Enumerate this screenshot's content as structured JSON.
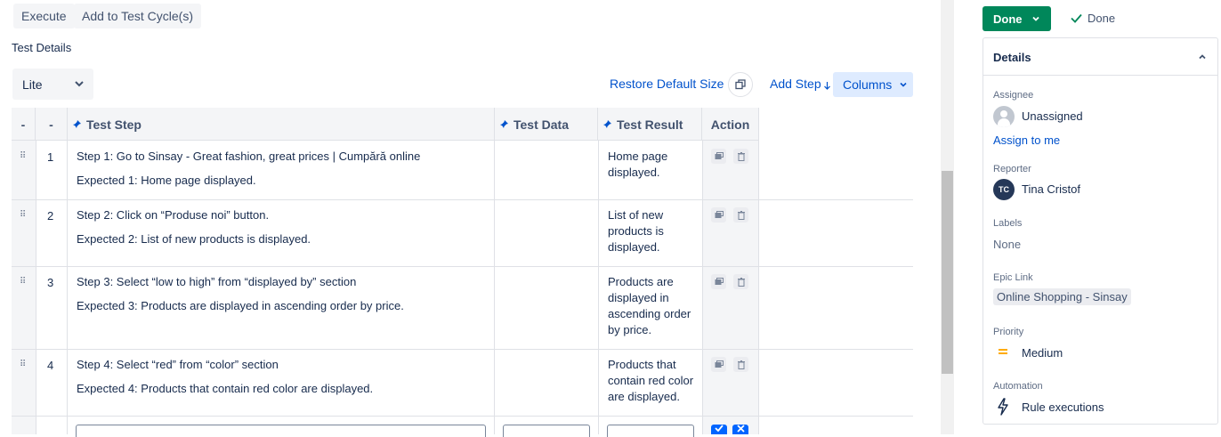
{
  "toolbar": {
    "execute": "Execute",
    "add_to_cycle": "Add to Test Cycle(s)"
  },
  "section_title": "Test Details",
  "view_select": {
    "value": "Lite"
  },
  "actions": {
    "restore": "Restore Default Size",
    "add_step": "Add Step",
    "columns": "Columns"
  },
  "table": {
    "headers": {
      "col1": "-",
      "col2": "-",
      "step": "Test Step",
      "data": "Test Data",
      "result": "Test Result",
      "action": "Action"
    },
    "rows": [
      {
        "num": "1",
        "step": "Step 1: Go to Sinsay - Great fashion, great prices | Cumpără online",
        "expected": "Expected 1: Home page displayed.",
        "result_lines": [
          "Home page",
          "displayed."
        ]
      },
      {
        "num": "2",
        "step": "Step 2: Click on “Produse noi” button.",
        "expected": "Expected 2: List of new products is displayed.",
        "result_lines": [
          "List of new",
          "products is",
          "displayed."
        ]
      },
      {
        "num": "3",
        "step": "Step 3: Select “low to high” from “displayed by” section",
        "expected": "Expected 3: Products are displayed in ascending order by price.",
        "result_lines": [
          "Products are",
          "displayed in",
          "ascending order",
          "by price."
        ]
      },
      {
        "num": "4",
        "step": "Step 4: Select “red” from “color” section",
        "expected": "Expected 4: Products that contain red color are displayed.",
        "result_lines": [
          "Products that",
          "contain red color",
          "are displayed."
        ]
      }
    ]
  },
  "status": {
    "button": "Done",
    "resolution": "Done"
  },
  "details": {
    "title": "Details",
    "assignee_label": "Assignee",
    "assignee": "Unassigned",
    "assign_to_me": "Assign to me",
    "reporter_label": "Reporter",
    "reporter_initials": "TC",
    "reporter": "Tina Cristof",
    "labels_label": "Labels",
    "labels": "None",
    "epic_label": "Epic Link",
    "epic": "Online Shopping - Sinsay",
    "priority_label": "Priority",
    "priority": "Medium",
    "automation_label": "Automation",
    "automation": "Rule executions"
  },
  "colors": {
    "primary": "#0052cc",
    "success": "#00875a",
    "priority_medium": "#ffab00"
  }
}
